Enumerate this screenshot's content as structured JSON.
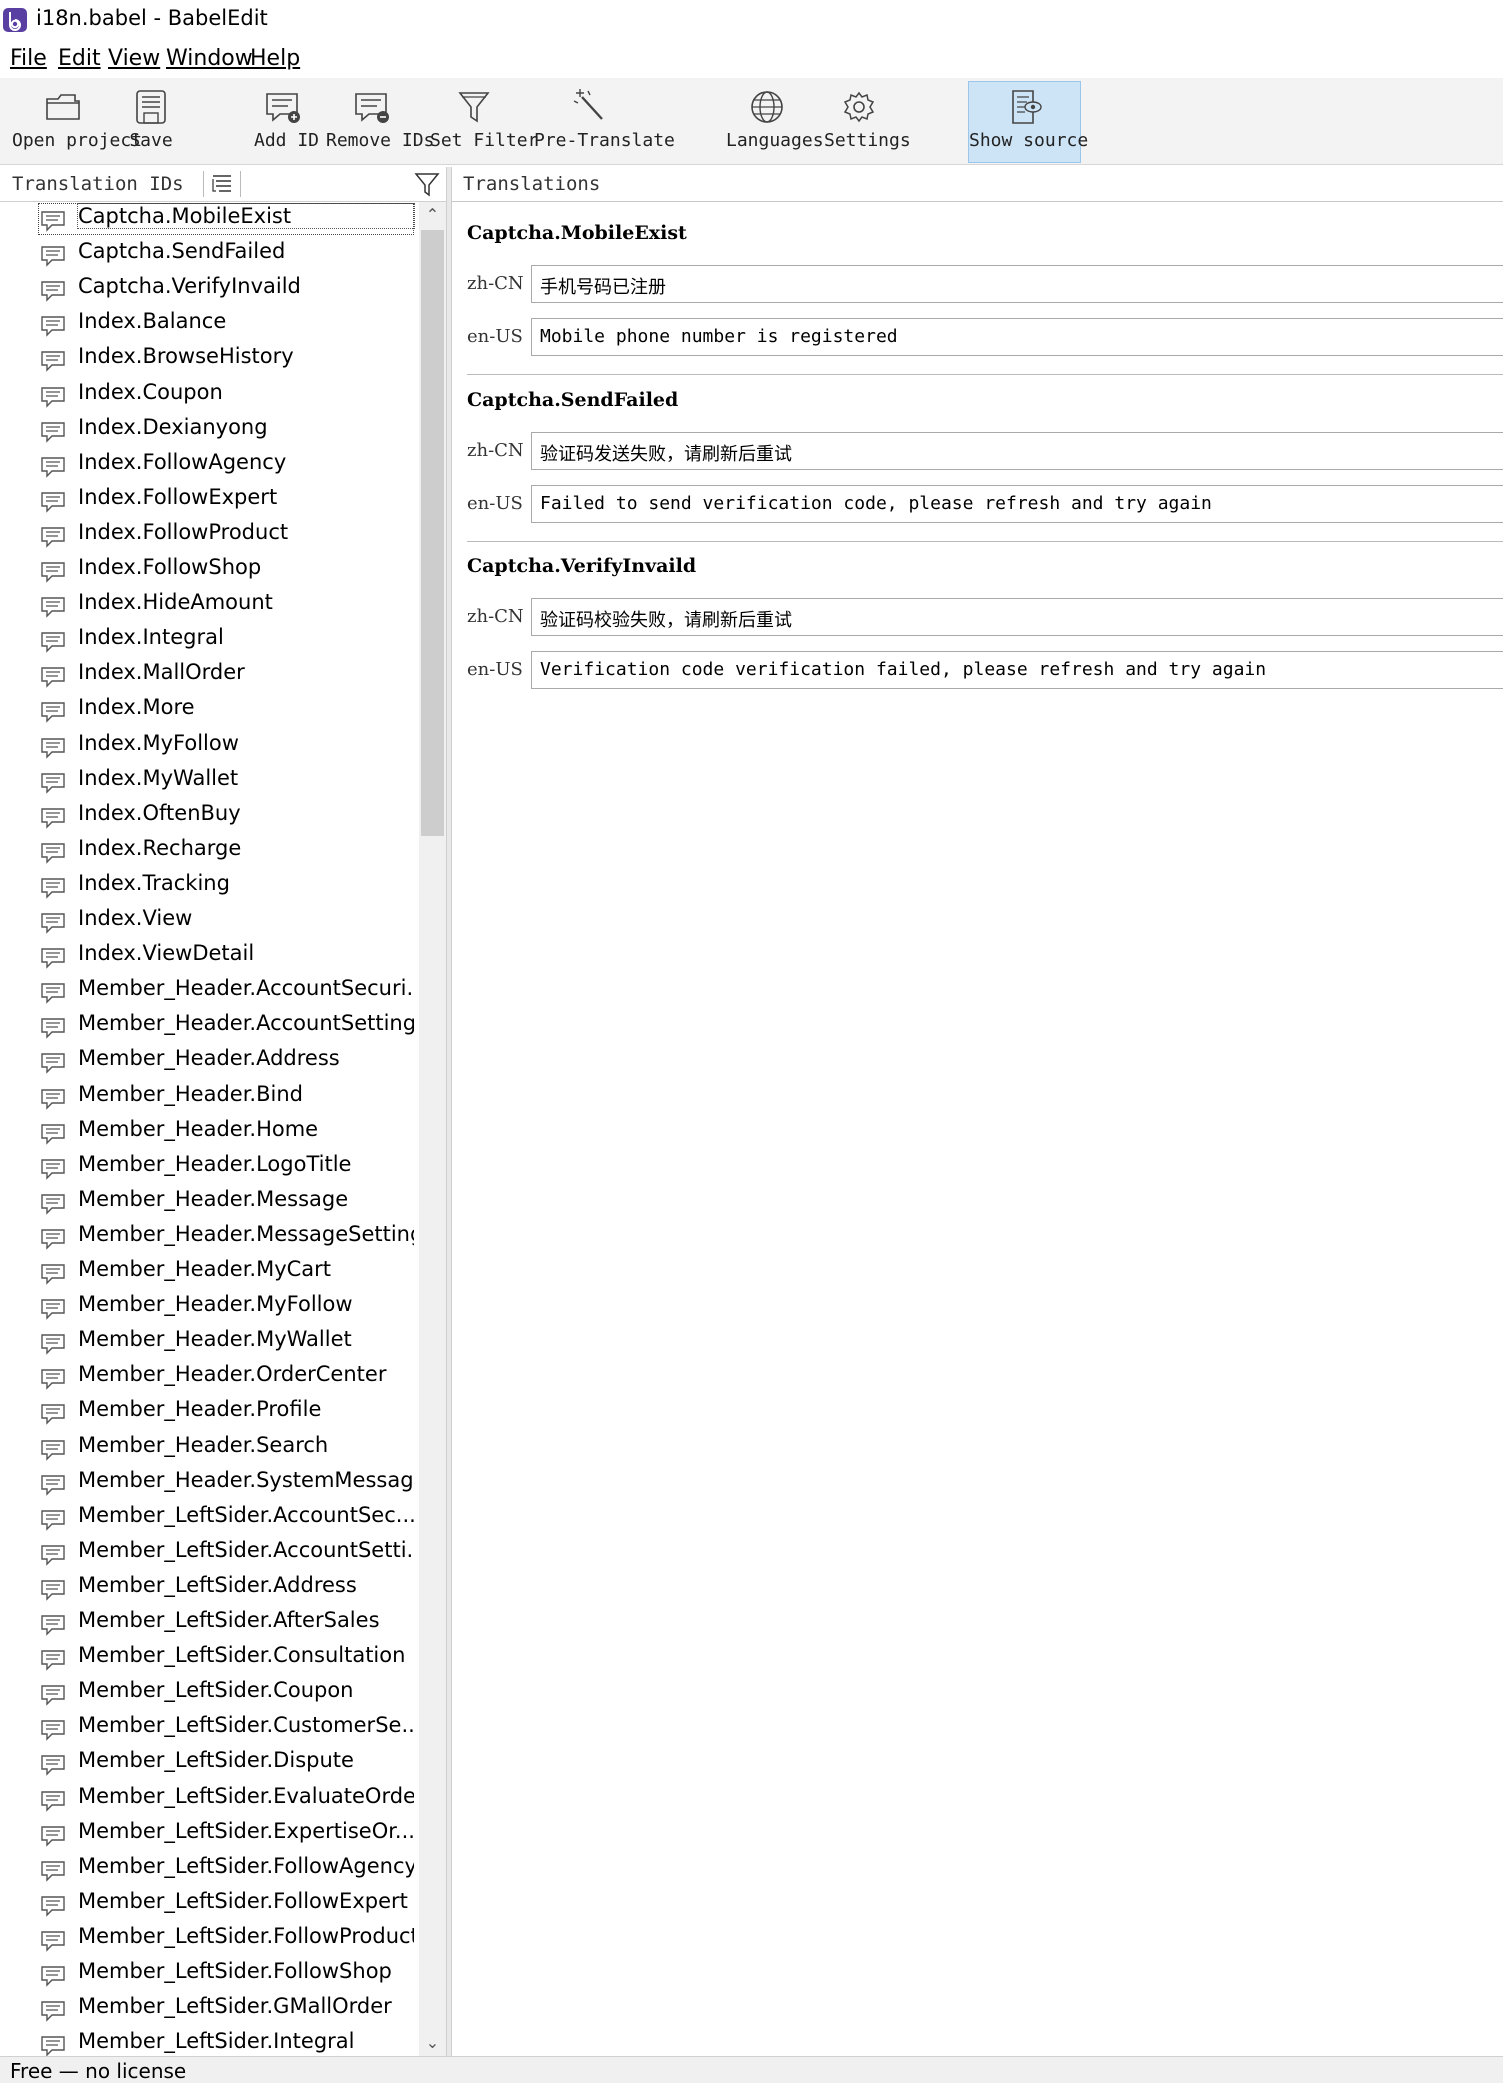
{
  "window": {
    "title": "i18n.babel - BabelEdit"
  },
  "menu": [
    {
      "label": "File"
    },
    {
      "label": "Edit"
    },
    {
      "label": "View"
    },
    {
      "label": "Window"
    },
    {
      "label": "Help"
    }
  ],
  "toolbar": {
    "open_project": "Open project",
    "save": "Save",
    "add_id": "Add ID",
    "remove_ids": "Remove IDs",
    "set_filter": "Set Filter",
    "pre_translate": "Pre-Translate",
    "languages": "Languages",
    "settings": "Settings",
    "show_source": "Show source"
  },
  "left_panel": {
    "header": "Translation IDs",
    "selected": "Captcha.MobileExist",
    "items": [
      "Captcha.MobileExist",
      "Captcha.SendFailed",
      "Captcha.VerifyInvaild",
      "Index.Balance",
      "Index.BrowseHistory",
      "Index.Coupon",
      "Index.Dexianyong",
      "Index.FollowAgency",
      "Index.FollowExpert",
      "Index.FollowProduct",
      "Index.FollowShop",
      "Index.HideAmount",
      "Index.Integral",
      "Index.MallOrder",
      "Index.More",
      "Index.MyFollow",
      "Index.MyWallet",
      "Index.OftenBuy",
      "Index.Recharge",
      "Index.Tracking",
      "Index.View",
      "Index.ViewDetail",
      "Member_Header.AccountSecuri...",
      "Member_Header.AccountSetting",
      "Member_Header.Address",
      "Member_Header.Bind",
      "Member_Header.Home",
      "Member_Header.LogoTitle",
      "Member_Header.Message",
      "Member_Header.MessageSetting",
      "Member_Header.MyCart",
      "Member_Header.MyFollow",
      "Member_Header.MyWallet",
      "Member_Header.OrderCenter",
      "Member_Header.Profile",
      "Member_Header.Search",
      "Member_Header.SystemMessage",
      "Member_LeftSider.AccountSec...",
      "Member_LeftSider.AccountSetti...",
      "Member_LeftSider.Address",
      "Member_LeftSider.AfterSales",
      "Member_LeftSider.Consultation",
      "Member_LeftSider.Coupon",
      "Member_LeftSider.CustomerSe...",
      "Member_LeftSider.Dispute",
      "Member_LeftSider.EvaluateOrder",
      "Member_LeftSider.ExpertiseOr...",
      "Member_LeftSider.FollowAgency",
      "Member_LeftSider.FollowExpert",
      "Member_LeftSider.FollowProduct",
      "Member_LeftSider.FollowShop",
      "Member_LeftSider.GMallOrder",
      "Member_LeftSider.Integral"
    ]
  },
  "right_panel": {
    "header": "Translations",
    "groups": [
      {
        "key": "Captcha.MobileExist",
        "rows": [
          {
            "lang": "zh-CN",
            "text": "手机号码已注册"
          },
          {
            "lang": "en-US",
            "text": "Mobile phone number is registered"
          }
        ]
      },
      {
        "key": "Captcha.SendFailed",
        "rows": [
          {
            "lang": "zh-CN",
            "text": "验证码发送失败，请刷新后重试"
          },
          {
            "lang": "en-US",
            "text": "Failed to send verification code, please refresh and try again"
          }
        ]
      },
      {
        "key": "Captcha.VerifyInvaild",
        "rows": [
          {
            "lang": "zh-CN",
            "text": "验证码校验失败，请刷新后重试"
          },
          {
            "lang": "en-US",
            "text": "Verification code verification failed, please refresh and try again"
          }
        ]
      }
    ]
  },
  "status": {
    "text": "Free — no license"
  },
  "colors": {
    "toolbar_bg": "#f3f3f3",
    "active_tool_bg": "#cde4f7",
    "app_icon": "#5a3fa3"
  }
}
